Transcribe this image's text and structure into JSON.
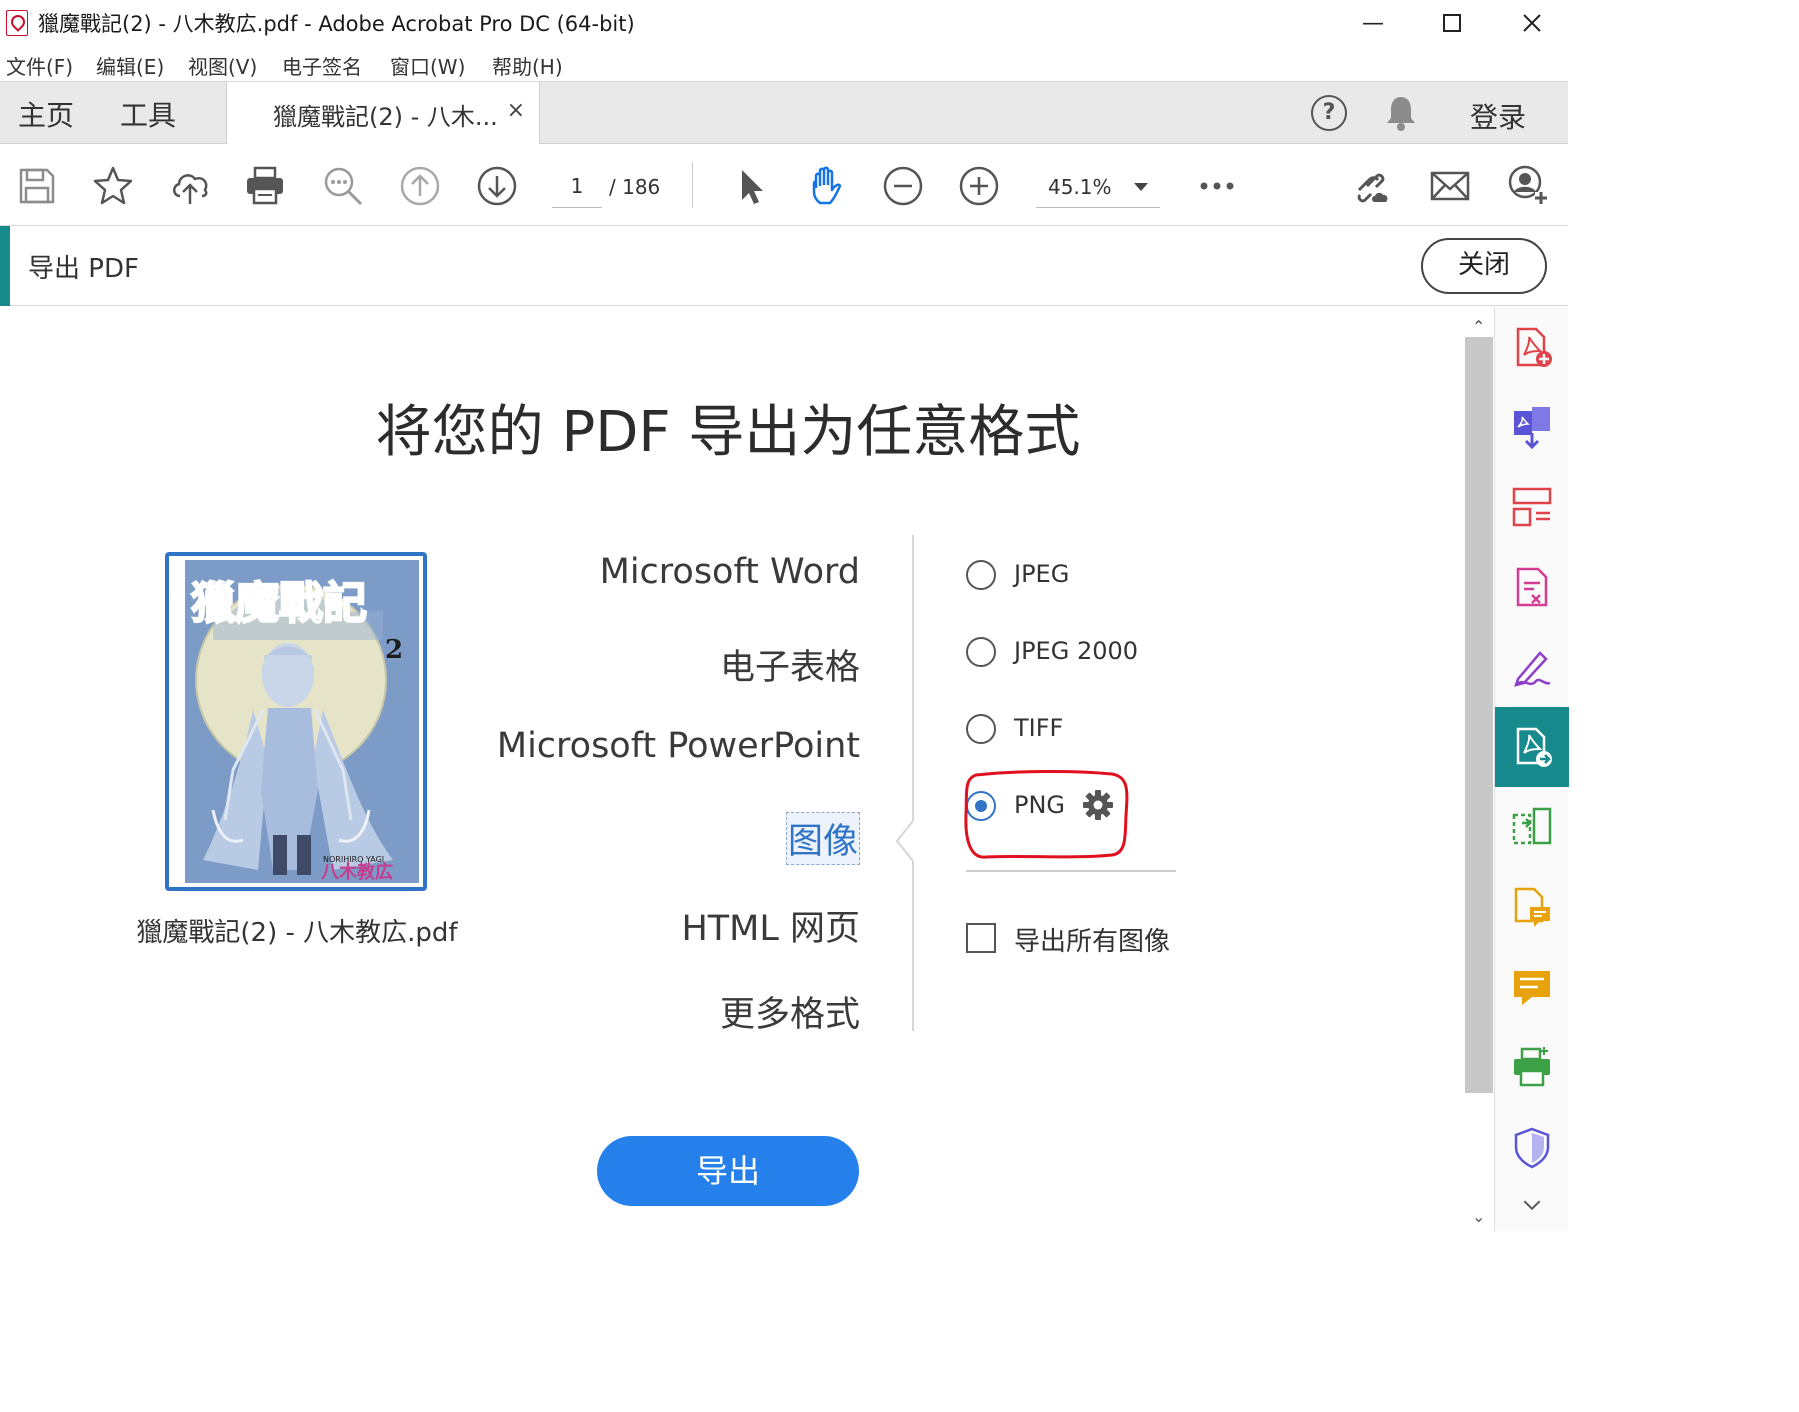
{
  "window": {
    "title": "獵魔戰記(2) - 八木教広.pdf - Adobe Acrobat Pro DC (64-bit)",
    "minimize_glyph": "—",
    "maximize_glyph": "☐",
    "close_glyph": "✕"
  },
  "menu": {
    "items": [
      "文件(F)",
      "编辑(E)",
      "视图(V)",
      "电子签名",
      "窗口(W)",
      "帮助(H)"
    ]
  },
  "tabs": {
    "home": "主页",
    "tools": "工具",
    "document": "獵魔戰記(2) - 八木...",
    "close_glyph": "×",
    "help_glyph": "?",
    "sign_in": "登录"
  },
  "toolbar": {
    "page_current": "1",
    "page_total": "/ 186",
    "zoom": "45.1%",
    "icons": [
      "save-icon",
      "bookmark-star-icon",
      "cloud-upload-icon",
      "print-icon",
      "find-zoom-icon",
      "page-up-icon",
      "page-down-icon",
      "select-cursor-icon",
      "hand-tool-icon",
      "zoom-out-icon",
      "zoom-in-icon",
      "more-icon",
      "share-link-icon",
      "mail-icon",
      "share-user-icon"
    ]
  },
  "panel": {
    "title": "导出 PDF",
    "close_label": "关闭"
  },
  "export": {
    "heading": "将您的 PDF 导出为任意格式",
    "file_name": "獵魔戰記(2) - 八木教広.pdf",
    "formats": [
      {
        "label": "Microsoft Word",
        "selected": false
      },
      {
        "label": "电子表格",
        "selected": false
      },
      {
        "label": "Microsoft PowerPoint",
        "selected": false
      },
      {
        "label": "图像",
        "selected": true
      },
      {
        "label": "HTML 网页",
        "selected": false
      },
      {
        "label": "更多格式",
        "selected": false
      }
    ],
    "image_options": [
      {
        "label": "JPEG",
        "checked": false
      },
      {
        "label": "JPEG 2000",
        "checked": false
      },
      {
        "label": "TIFF",
        "checked": false
      },
      {
        "label": "PNG",
        "checked": true
      }
    ],
    "export_all_images_label": "导出所有图像",
    "export_all_images_checked": false,
    "export_button": "导出"
  },
  "cover": {
    "title_art": "獵魔戰記",
    "volume": "2",
    "author_romaji": "NORIHIRO YAGI",
    "author": "八木教広"
  },
  "colors": {
    "accent_teal": "#178a8d",
    "selected_blue": "#2f74c7",
    "export_button": "#2680eb",
    "annotation_red": "#e0101e"
  },
  "rail": {
    "icons": [
      "create-pdf-icon",
      "combine-files-icon",
      "organize-pages-icon",
      "edit-pdf-icon",
      "fill-sign-icon",
      "export-pdf-icon",
      "compare-files-icon",
      "comment-file-icon",
      "comment-icon",
      "print-production-icon",
      "protect-icon"
    ]
  }
}
